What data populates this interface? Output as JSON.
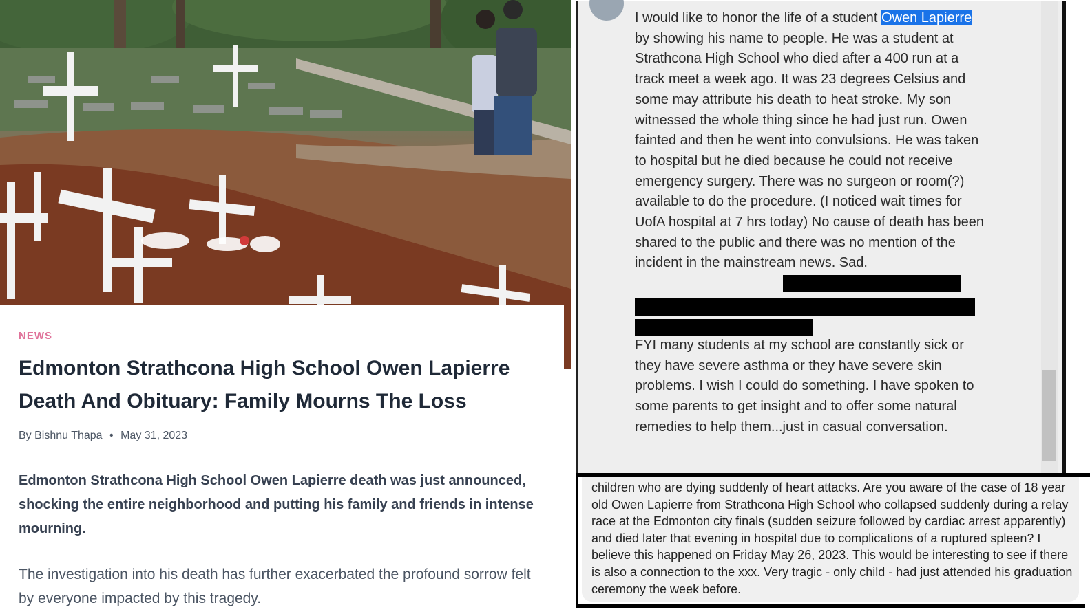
{
  "article": {
    "category": "NEWS",
    "headline": "Edmonton Strathcona High School Owen Lapierre Death And Obituary: Family Mourns The Loss",
    "byline_prefix": "By",
    "author": "Bishnu Thapa",
    "byline_separator": "•",
    "date": "May 31, 2023",
    "lead": "Edmonton Strathcona High School Owen Lapierre death was just announced, shocking the entire neighborhood and putting his family and friends in intense mourning.",
    "body": "The investigation into his death has further exacerbated the profound sorrow felt by everyone impacted by this tragedy."
  },
  "comment_one": {
    "text_before_highlight": "I would like to honor the life of a student ",
    "highlight": "Owen Lapierre",
    "text_after_highlight": " by showing his name to people. He was a student at Strathcona High School who died after a 400 run at a track meet a week ago. It was 23 degrees Celsius and some may attribute his death to heat stroke. My son witnessed the whole thing since he had just run. Owen fainted and then he went into convulsions. He was taken to hospital but he died because he could not receive emergency surgery. There was no surgeon or room(?) available to do the procedure. (I noticed wait times for UofA hospital at 7 hrs today) No cause of death has been shared to the public and there was no mention of the incident in the mainstream news. Sad.",
    "text_second_paragraph": "FYI many students at my school are constantly sick or they have severe asthma or they have severe skin problems. I wish I could do something. I have spoken to some parents to get insight and to offer some natural remedies to help them...just in casual conversation."
  },
  "comment_two": {
    "text": "children who are dying suddenly of heart attacks. Are you aware of the case of 18 year old Owen Lapierre from Strathcona High School who collapsed suddenly during a relay race at the Edmonton city finals (sudden seizure followed by cardiac arrest apparently) and died later that evening in hospital due to complications of a ruptured spleen? I believe this happened on Friday May 26, 2023. This would be interesting to see if there is also a connection to the xxx. Very tragic - only child - had just attended his graduation ceremony the week before."
  },
  "colors": {
    "kicker": "#e0739a",
    "headline": "#1f2937",
    "highlight": "#1a73e8",
    "comment_bg": "#eeeeee"
  },
  "icons": {
    "avatar": "user-avatar-icon"
  }
}
